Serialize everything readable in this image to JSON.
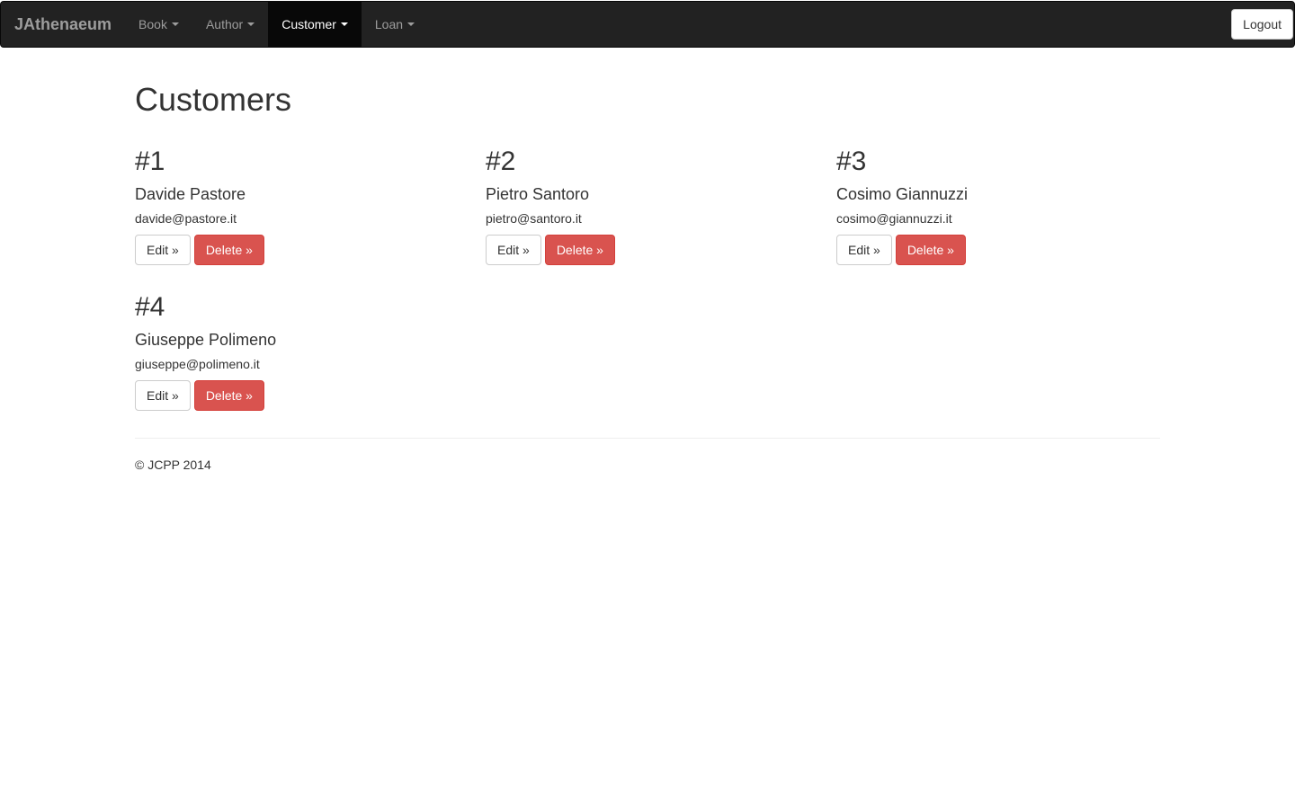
{
  "navbar": {
    "brand": "JAthenaeum",
    "items": [
      {
        "label": "Book",
        "active": false
      },
      {
        "label": "Author",
        "active": false
      },
      {
        "label": "Customer",
        "active": true
      },
      {
        "label": "Loan",
        "active": false
      }
    ],
    "logout_label": "Logout"
  },
  "page": {
    "title": "Customers"
  },
  "customers": [
    {
      "number": "#1",
      "name": "Davide Pastore",
      "email": "davide@pastore.it",
      "edit_label": "Edit »",
      "delete_label": "Delete »"
    },
    {
      "number": "#2",
      "name": "Pietro Santoro",
      "email": "pietro@santoro.it",
      "edit_label": "Edit »",
      "delete_label": "Delete »"
    },
    {
      "number": "#3",
      "name": "Cosimo Giannuzzi",
      "email": "cosimo@giannuzzi.it",
      "edit_label": "Edit »",
      "delete_label": "Delete »"
    },
    {
      "number": "#4",
      "name": "Giuseppe Polimeno",
      "email": "giuseppe@polimeno.it",
      "edit_label": "Edit »",
      "delete_label": "Delete »"
    }
  ],
  "footer": {
    "text": "© JCPP 2014"
  },
  "colors": {
    "navbar_bg": "#222222",
    "navbar_active": "#080808",
    "danger": "#d9534f"
  }
}
